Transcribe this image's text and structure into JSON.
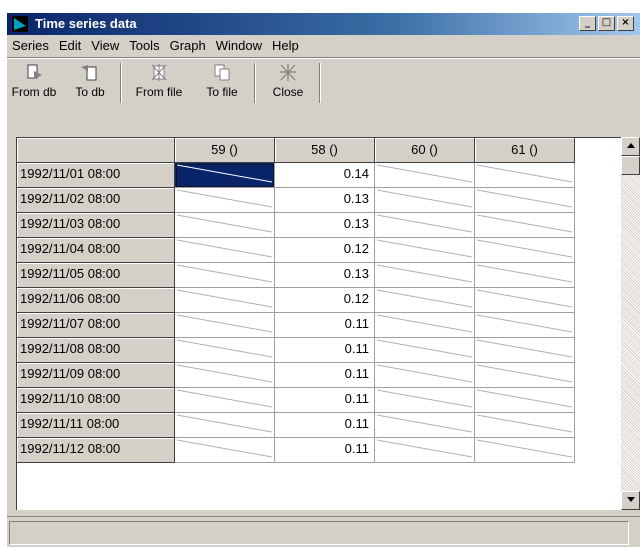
{
  "window": {
    "title": "Time series data",
    "minimize": "_",
    "maximize": "□",
    "close": "×"
  },
  "menu": [
    "Series",
    "Edit",
    "View",
    "Tools",
    "Graph",
    "Window",
    "Help"
  ],
  "toolbar": {
    "from_db": "From db",
    "to_db": "To db",
    "from_file": "From file",
    "to_file": "To file",
    "close": "Close"
  },
  "grid": {
    "columns": [
      "59 ()",
      "58 ()",
      "60 ()",
      "61 ()"
    ],
    "rows": [
      {
        "date": "1992/11/01 08:00",
        "value": "0.14"
      },
      {
        "date": "1992/11/02 08:00",
        "value": "0.13"
      },
      {
        "date": "1992/11/03 08:00",
        "value": "0.13"
      },
      {
        "date": "1992/11/04 08:00",
        "value": "0.12"
      },
      {
        "date": "1992/11/05 08:00",
        "value": "0.13"
      },
      {
        "date": "1992/11/06 08:00",
        "value": "0.12"
      },
      {
        "date": "1992/11/07 08:00",
        "value": "0.11"
      },
      {
        "date": "1992/11/08 08:00",
        "value": "0.11"
      },
      {
        "date": "1992/11/09 08:00",
        "value": "0.11"
      },
      {
        "date": "1992/11/10 08:00",
        "value": "0.11"
      },
      {
        "date": "1992/11/11 08:00",
        "value": "0.11"
      },
      {
        "date": "1992/11/12 08:00",
        "value": "0.11"
      }
    ]
  },
  "colors": {
    "title_start": "#0a246a",
    "title_end": "#a6caf0",
    "selection": "#0a246a",
    "face": "#d4d0c8"
  }
}
